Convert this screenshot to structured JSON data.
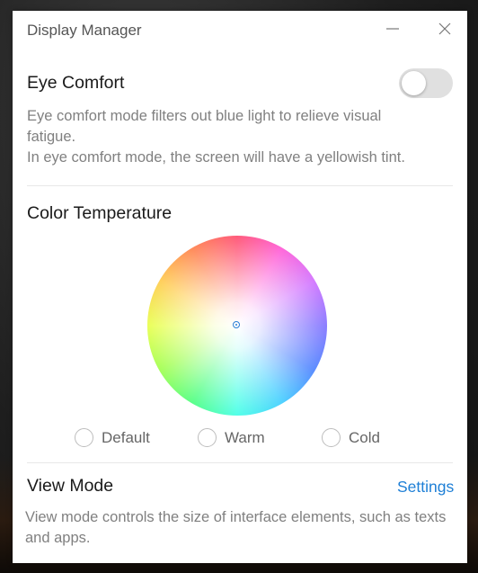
{
  "window": {
    "title": "Display Manager"
  },
  "eye_comfort": {
    "title": "Eye Comfort",
    "enabled": false,
    "description_line1": "Eye comfort mode filters out blue light to relieve visual",
    "description_line2": "fatigue.",
    "description_line3": "In eye comfort mode, the screen will have a yellowish tint."
  },
  "color_temperature": {
    "title": "Color Temperature",
    "options": [
      {
        "label": "Default",
        "selected": false
      },
      {
        "label": "Warm",
        "selected": false
      },
      {
        "label": "Cold",
        "selected": false
      }
    ]
  },
  "view_mode": {
    "title": "View Mode",
    "settings_link": "Settings",
    "description_line1": "View mode controls the size of interface elements, such as texts",
    "description_line2": "and apps."
  },
  "colors": {
    "accent": "#1e7fd6",
    "toggle_off": "#e0e0e0"
  },
  "icons": {
    "minimize": "minimize-icon",
    "close": "close-icon",
    "marker": "crosshair-icon"
  }
}
